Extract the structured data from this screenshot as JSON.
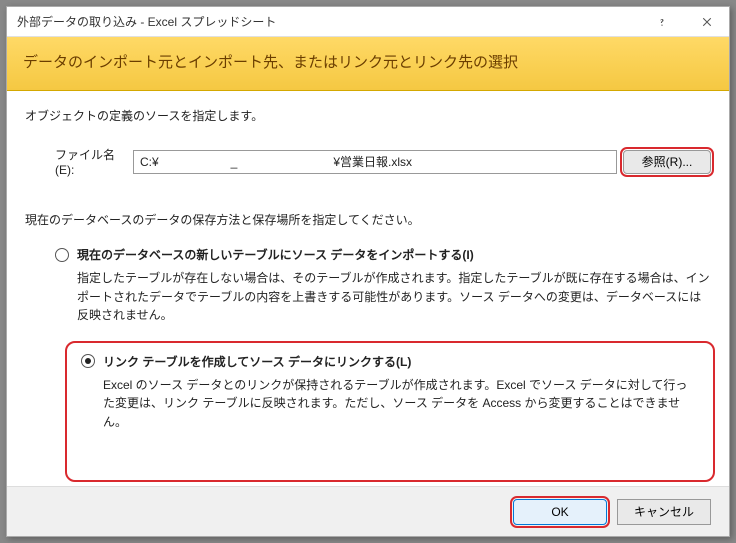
{
  "titlebar": {
    "title": "外部データの取り込み - Excel スプレッドシート"
  },
  "banner": {
    "heading": "データのインポート元とインポート先、またはリンク元とリンク先の選択"
  },
  "content": {
    "instruction": "オブジェクトの定義のソースを指定します。",
    "file_label": "ファイル名(E):",
    "file_value": "C:¥　　　　　　_　　　　　　　　¥営業日報.xlsx",
    "browse_label": "参照(R)...",
    "sub_instruction": "現在のデータベースのデータの保存方法と保存場所を指定してください。",
    "option1": {
      "title": "現在のデータベースの新しいテーブルにソース データをインポートする(I)",
      "desc": "指定したテーブルが存在しない場合は、そのテーブルが作成されます。指定したテーブルが既に存在する場合は、インポートされたデータでテーブルの内容を上書きする可能性があります。ソース データへの変更は、データベースには反映されません。"
    },
    "option2": {
      "title": "リンク テーブルを作成してソース データにリンクする(L)",
      "desc": "Excel のソース データとのリンクが保持されるテーブルが作成されます。Excel でソース データに対して行った変更は、リンク テーブルに反映されます。ただし、ソース データを Access から変更することはできません。"
    }
  },
  "footer": {
    "ok": "OK",
    "cancel": "キャンセル"
  }
}
